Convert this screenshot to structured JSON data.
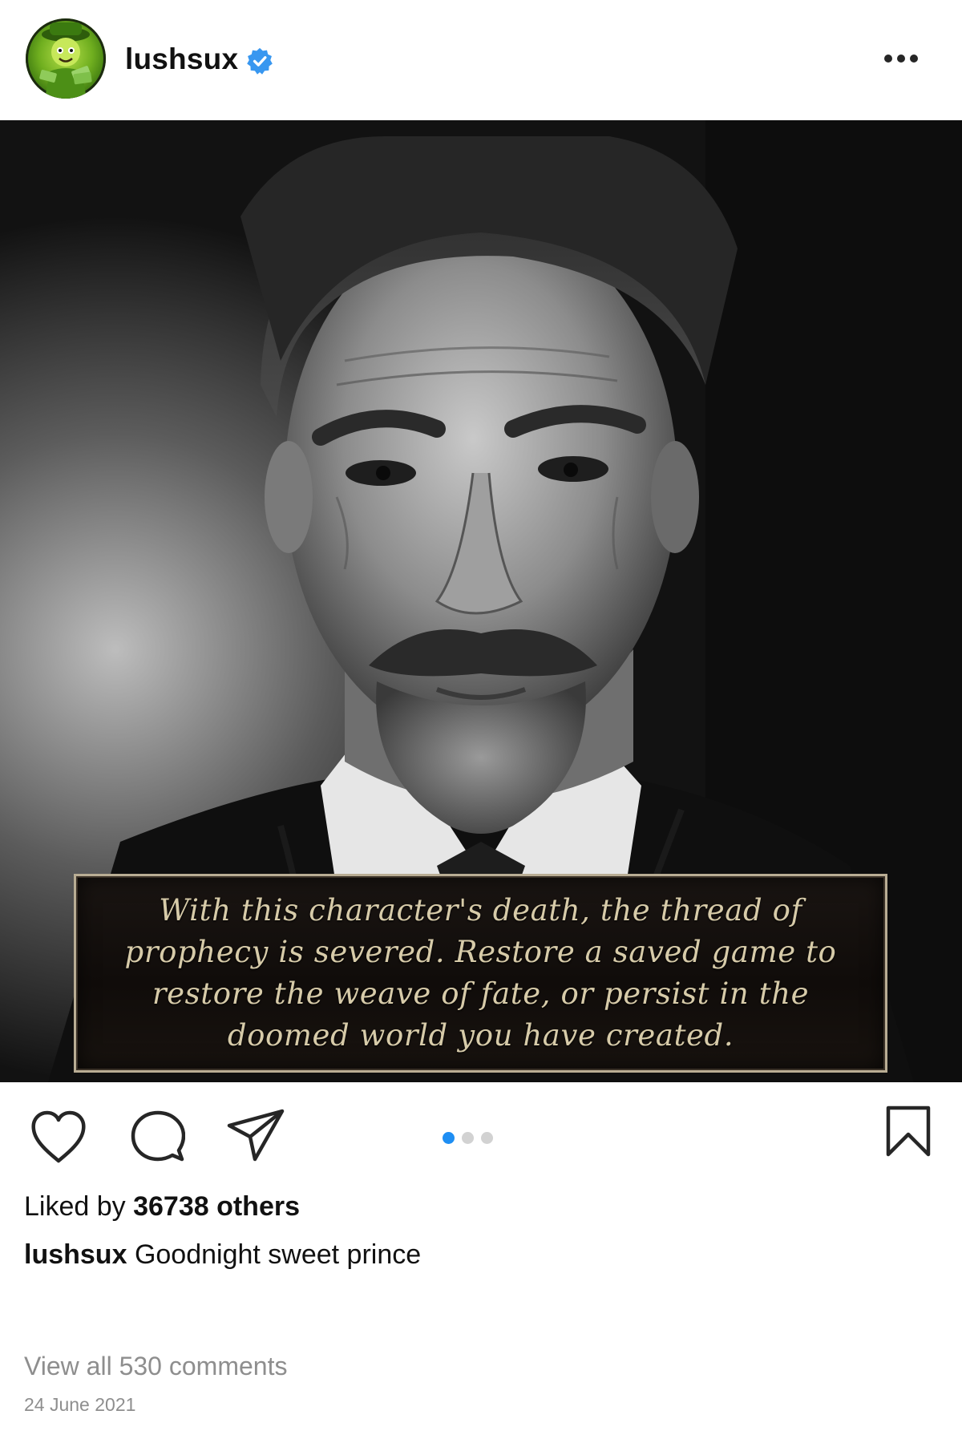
{
  "post": {
    "username": "lushsux",
    "verified": true,
    "verified_color": "#3897f0",
    "avatar_description": "green-cartoon-avatar",
    "image": {
      "overlay_text": "With this character's death, the thread of prophecy is severed. Restore a saved game to restore the weave of fate, or persist in the doomed world you have created.",
      "carousel_total": 3,
      "carousel_active": 1,
      "carousel_active_color": "#1e8ef3",
      "carousel_inactive_color": "#d2d2d2"
    },
    "actions": {
      "like_icon": "heart-icon",
      "comment_icon": "comment-icon",
      "share_icon": "paper-plane-icon",
      "save_icon": "bookmark-icon",
      "more_icon": "more-horizontal-icon"
    },
    "likes": {
      "prefix": "Liked by",
      "count_text": "36738 others"
    },
    "caption": {
      "username": "lushsux",
      "text": "Goodnight sweet prince"
    },
    "comments_link": "View all 530 comments",
    "date": "24 June 2021"
  }
}
